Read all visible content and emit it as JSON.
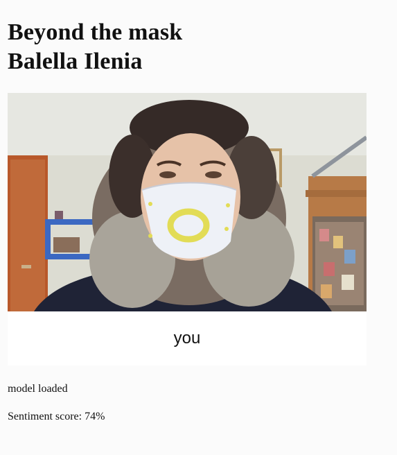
{
  "header": {
    "title_line1": "Beyond the mask",
    "title_line2": "Balella Ilenia"
  },
  "webcam": {
    "label": "you",
    "overlay_color": "#e2dc56"
  },
  "status": {
    "model_text": "model loaded",
    "sentiment_text": "Sentiment score: 74%"
  }
}
